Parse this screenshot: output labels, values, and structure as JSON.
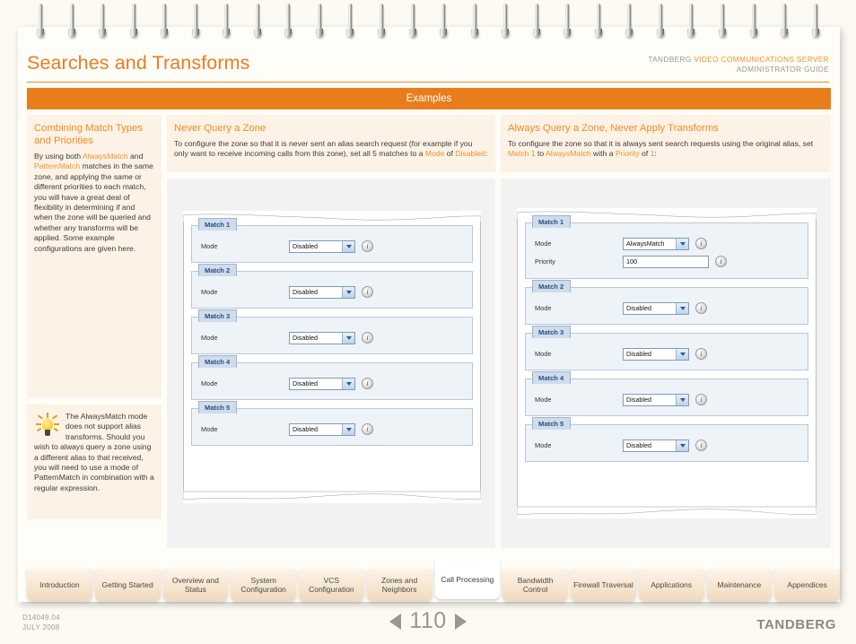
{
  "header": {
    "title": "Searches and Transforms",
    "brand_prefix": "TANDBERG ",
    "brand_product": "VIDEO COMMUNICATIONS SERVER",
    "guide_line2": "ADMINISTRATOR GUIDE",
    "section_banner": "Examples"
  },
  "colors": {
    "accent": "#ea7c1f",
    "banner": "#e87e1b",
    "card_bg": "#fdf2e6",
    "page_bg": "#fdfaf4",
    "panel_blue": "#eef3f8",
    "legend_blue": "#cfdced",
    "brand_gray": "#8b8884"
  },
  "left_column": {
    "title": "Combining Match Types and Priorities",
    "paragraph_parts": [
      {
        "text": "By using both ",
        "hl": false
      },
      {
        "text": "AlwaysMatch",
        "hl": true
      },
      {
        "text": " and ",
        "hl": false
      },
      {
        "text": "PatternMatch",
        "hl": true
      },
      {
        "text": " matches in the same zone, and applying the same or different priorities to each match, you will have a great deal of flexibility in determining if and when the zone will be queried and whether any transforms will be applied.  Some example configurations are given here.",
        "hl": false
      }
    ],
    "tip": {
      "icon": "lightbulb-icon",
      "parts": [
        {
          "text": "The ",
          "hl": false
        },
        {
          "text": "AlwaysMatch",
          "hl": true
        },
        {
          "text": " mode does not support alias transforms.  Should you wish to always query a zone using a different alias to that received, you will need to use a mode of ",
          "hl": false
        },
        {
          "text": "PatternMatch",
          "hl": true
        },
        {
          "text": " in combination with a regular expression.",
          "hl": false
        }
      ]
    }
  },
  "middle_column": {
    "title": "Never Query a Zone",
    "paragraph_parts": [
      {
        "text": "To configure the zone so that it is never sent an alias search request (for example if you only want to receive incoming calls from this zone), set all 5 matches to a ",
        "hl": false
      },
      {
        "text": "Mode",
        "hl": true
      },
      {
        "text": " of ",
        "hl": false
      },
      {
        "text": "Disabled",
        "hl": true
      },
      {
        "text": ":",
        "hl": false
      }
    ],
    "screenshot": {
      "name": "vcs-never-query-screenshot",
      "matches": [
        {
          "legend": "Match 1",
          "fields": [
            {
              "label": "Mode",
              "type": "select",
              "value": "Disabled"
            }
          ]
        },
        {
          "legend": "Match 2",
          "fields": [
            {
              "label": "Mode",
              "type": "select",
              "value": "Disabled"
            }
          ]
        },
        {
          "legend": "Match 3",
          "fields": [
            {
              "label": "Mode",
              "type": "select",
              "value": "Disabled"
            }
          ]
        },
        {
          "legend": "Match 4",
          "fields": [
            {
              "label": "Mode",
              "type": "select",
              "value": "Disabled"
            }
          ]
        },
        {
          "legend": "Match 5",
          "fields": [
            {
              "label": "Mode",
              "type": "select",
              "value": "Disabled"
            }
          ]
        }
      ]
    }
  },
  "right_column": {
    "title": "Always Query a Zone, Never Apply Transforms",
    "paragraph_parts": [
      {
        "text": "To configure the zone so that it is always sent search requests using the original alias, set ",
        "hl": false
      },
      {
        "text": "Match 1",
        "hl": true
      },
      {
        "text": " to ",
        "hl": false
      },
      {
        "text": "AlwaysMatch",
        "hl": true
      },
      {
        "text": " with a ",
        "hl": false
      },
      {
        "text": "Priority",
        "hl": true
      },
      {
        "text": " of ",
        "hl": false
      },
      {
        "text": "1",
        "hl": true
      },
      {
        "text": ":",
        "hl": false
      }
    ],
    "screenshot": {
      "name": "vcs-always-query-screenshot",
      "matches": [
        {
          "legend": "Match 1",
          "fields": [
            {
              "label": "Mode",
              "type": "select",
              "value": "AlwaysMatch"
            },
            {
              "label": "Priority",
              "type": "text",
              "value": "100"
            }
          ]
        },
        {
          "legend": "Match 2",
          "fields": [
            {
              "label": "Mode",
              "type": "select",
              "value": "Disabled"
            }
          ]
        },
        {
          "legend": "Match 3",
          "fields": [
            {
              "label": "Mode",
              "type": "select",
              "value": "Disabled"
            }
          ]
        },
        {
          "legend": "Match 4",
          "fields": [
            {
              "label": "Mode",
              "type": "select",
              "value": "Disabled"
            }
          ]
        },
        {
          "legend": "Match 5",
          "fields": [
            {
              "label": "Mode",
              "type": "select",
              "value": "Disabled"
            }
          ]
        }
      ]
    }
  },
  "tabs": [
    {
      "label": "Introduction",
      "active": false
    },
    {
      "label": "Getting Started",
      "active": false
    },
    {
      "label": "Overview and Status",
      "active": false
    },
    {
      "label": "System Configuration",
      "active": false
    },
    {
      "label": "VCS Configuration",
      "active": false
    },
    {
      "label": "Zones and Neighbors",
      "active": false
    },
    {
      "label": "Call Processing",
      "active": true
    },
    {
      "label": "Bandwidth Control",
      "active": false
    },
    {
      "label": "Firewall Traversal",
      "active": false
    },
    {
      "label": "Applications",
      "active": false
    },
    {
      "label": "Maintenance",
      "active": false
    },
    {
      "label": "Appendices",
      "active": false
    }
  ],
  "footer": {
    "doc_id": "D14049.04",
    "doc_date": "JULY 2008",
    "page_number": "110",
    "prev_icon": "left-triangle-icon",
    "next_icon": "right-triangle-icon",
    "brand": "TANDBERG"
  },
  "binding": {
    "ring_count": 26
  }
}
